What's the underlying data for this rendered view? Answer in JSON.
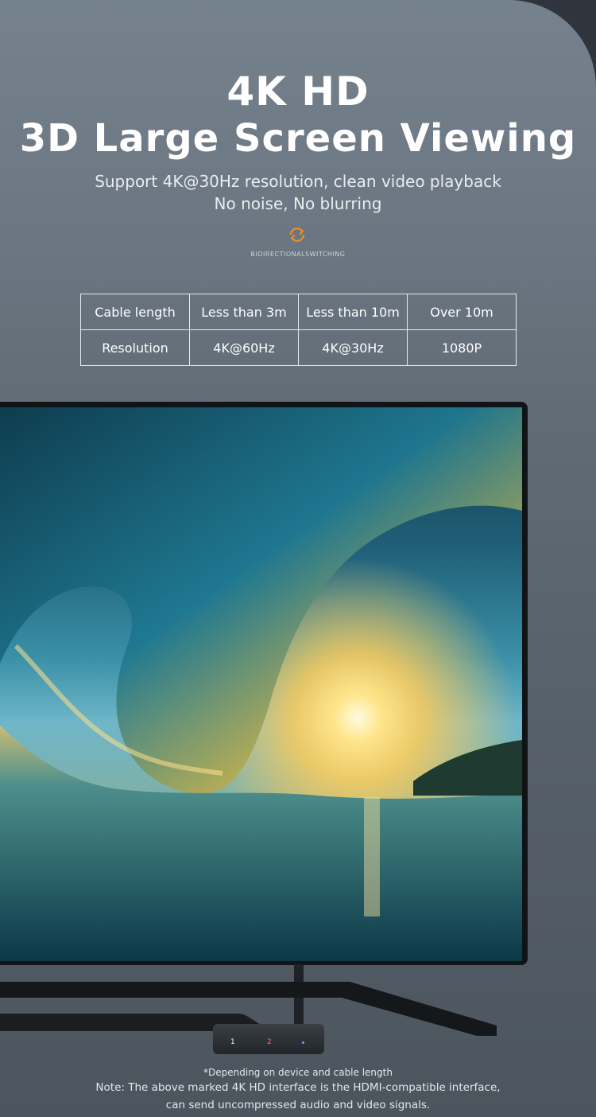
{
  "hero": {
    "title_line1": "4K HD",
    "title_line2": "3D Large Screen Viewing",
    "subtitle_line1": "Support 4K@30Hz resolution, clean video playback",
    "subtitle_line2": "No noise, No blurring"
  },
  "badge": {
    "icon": "bidirectional-switch-icon",
    "label": "BIDIRECTIONALSWITCHING",
    "color": "#f08a24"
  },
  "spec_table": {
    "rows": [
      [
        "Cable length",
        "Less than 3m",
        "Less than 10m",
        "Over 10m"
      ],
      [
        "Resolution",
        "4K@60Hz",
        "4K@30Hz",
        "1080P"
      ]
    ]
  },
  "device": {
    "port1": "1",
    "port2": "2"
  },
  "footnote": {
    "line1": "*Depending on device and cable length",
    "line2": "Note: The above marked 4K HD interface is  the HDMI-compatible interface,",
    "line3": "can send uncompressed audio and video signals."
  }
}
